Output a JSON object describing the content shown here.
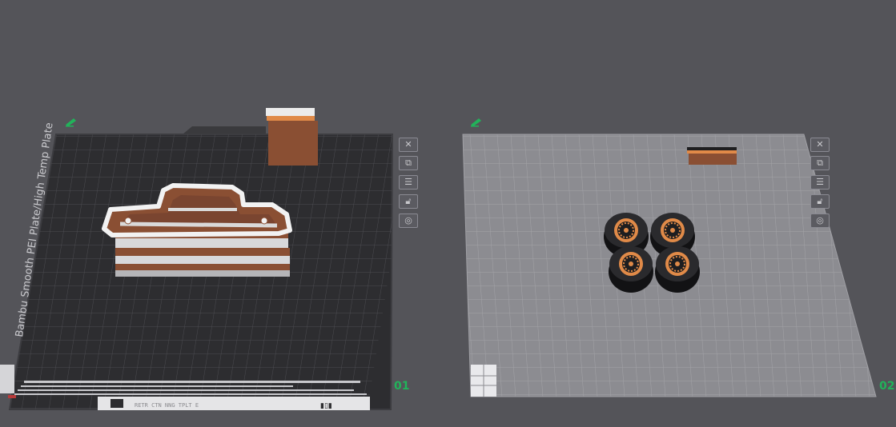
{
  "workspace": {
    "background_color": "#545459",
    "plate1": {
      "texture_label": "Bambu Smooth PEI Plate/High Temp Plate",
      "plate_number": "01",
      "bottom_label": "RETR CTN NNG TPLT E",
      "surface_color": "#2d2d30",
      "icons": [
        "close-icon",
        "arrange-icon",
        "settings-icon",
        "lock-icon",
        "view-icon"
      ]
    },
    "plate2": {
      "plate_number": "02",
      "surface_color": "#8c8c91",
      "icons": [
        "close-icon",
        "arrange-icon",
        "settings-icon",
        "lock-icon",
        "view-icon"
      ]
    },
    "model_colors": {
      "brown": "#8a4f33",
      "white": "#d9d9d9",
      "orange": "#e08a48",
      "tire": "#1e1e20"
    },
    "plate_number_color": "#21b35a"
  }
}
